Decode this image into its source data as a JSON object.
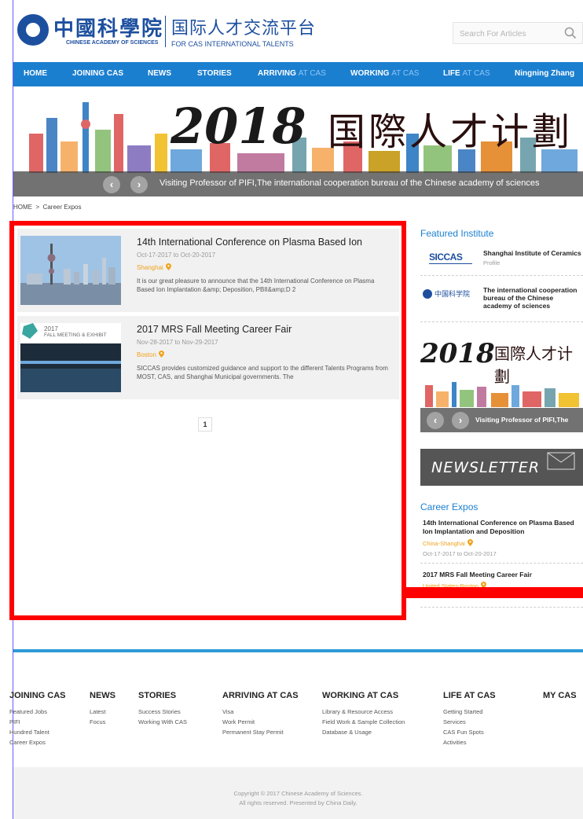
{
  "header": {
    "logo_cn": "中國科學院",
    "logo_en": "CHINESE ACADEMY OF SCIENCES",
    "platform_cn": "国际人才交流平台",
    "platform_en": "FOR CAS INTERNATIONAL TALENTS",
    "search_placeholder": "Search For Articles"
  },
  "nav": {
    "items": [
      {
        "label": "HOME",
        "light": ""
      },
      {
        "label": "JOINING CAS",
        "light": ""
      },
      {
        "label": "NEWS",
        "light": ""
      },
      {
        "label": "STORIES",
        "light": ""
      },
      {
        "label": "ARRIVING",
        "light": "AT CAS"
      },
      {
        "label": "WORKING",
        "light": "AT CAS"
      },
      {
        "label": "LIFE",
        "light": "AT CAS"
      }
    ],
    "user": "Ningning Zhang"
  },
  "banner": {
    "year": "2018",
    "title_cn": "国際人才计劃",
    "caption": "Visiting Professor of PIFI,The international cooperation bureau of the Chinese academy of sciences",
    "prev": "‹",
    "next": "›"
  },
  "breadcrumb": {
    "home": "HOME",
    "sep": ">",
    "current": "Career Expos"
  },
  "articles": [
    {
      "title": "14th International Conference on Plasma Based Ion",
      "date": "Oct-17-2017 to Oct-20-2017",
      "location": "Shanghai",
      "desc": "It is our great pleasure to announce that the 14th International Conference on Plasma Based Ion Implantation &amp; Deposition, PBII&amp;D 2"
    },
    {
      "title": "2017 MRS Fall Meeting Career Fair",
      "date": "Nov-28-2017 to Nov-29-2017",
      "location": "Boston",
      "desc": "SICCAS provides customized guidance and support to the different Talents Programs from MOST, CAS, and Shanghai Municipal governments. The",
      "thumb_label_year": "2017",
      "thumb_label": "FALL MEETING & EXHIBIT"
    }
  ],
  "pagination": {
    "current": "1"
  },
  "sidebar": {
    "featured_heading": "Featured Institute",
    "institutes": [
      {
        "logo": "SICCAS",
        "name": "Shanghai Institute of Ceramics",
        "sub": "Profile"
      },
      {
        "logo": "中国科学院",
        "name": "The international cooperation bureau of the Chinese academy of sciences",
        "sub": ""
      }
    ],
    "banner_year": "2018",
    "banner_cn": "国際人才计劃",
    "banner_caption": "Visiting Professor of PIFI,The",
    "newsletter": "NEWSLETTER",
    "expos_heading": "Career Expos",
    "expos": [
      {
        "title": "14th International Conference on Plasma Based Ion Implantation and Deposition",
        "location": "China-Shanghai",
        "date": "Oct-17-2017 to Oct-20-2017"
      },
      {
        "title": "2017 MRS Fall Meeting Career Fair",
        "location": "United States-Boston"
      }
    ]
  },
  "footer": {
    "columns": [
      {
        "title": "JOINING CAS",
        "links": [
          "Featured Jobs",
          "PIFI",
          "Hundred Talent",
          "Career Expos"
        ]
      },
      {
        "title": "NEWS",
        "links": [
          "Latest",
          "Focus"
        ]
      },
      {
        "title": "STORIES",
        "links": [
          "Success Stories",
          "Working With CAS"
        ]
      },
      {
        "title": "ARRIVING AT CAS",
        "links": [
          "Visa",
          "Work Permit",
          "Permanent Stay Permit"
        ]
      },
      {
        "title": "WORKING AT CAS",
        "links": [
          "Library & Resource Access",
          "Field Work & Sample Collection",
          "Database & Usage"
        ]
      },
      {
        "title": "LIFE AT CAS",
        "links": [
          "Getting Started",
          "Services",
          "CAS Fun Spots",
          "Activities"
        ]
      },
      {
        "title": "MY CAS",
        "links": []
      }
    ],
    "copyright_1": "Copyright © 2017 Chinese Academy of Sciences.",
    "copyright_2": "All rights reserved. Presented by China Daily."
  },
  "colors": {
    "nav_blue": "#1b7fd0",
    "accent_orange": "#f0a21a",
    "highlight_red": "#ff0000",
    "footer_blue": "#2e9ad5"
  }
}
